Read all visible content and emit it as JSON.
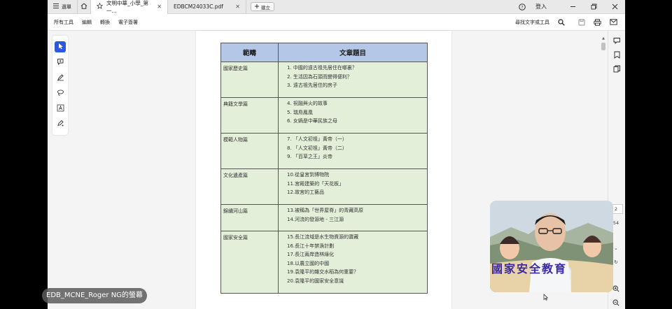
{
  "tabbar": {
    "menu_label": "選單",
    "tabs": [
      {
        "label": "文明中華_小學_第一...",
        "active": true
      },
      {
        "label": "EDBCM24033C.pdf",
        "active": false
      }
    ],
    "new_tab_label": "建立",
    "sign_in_label": "登入"
  },
  "toolbar": {
    "items": [
      "所有工具",
      "編輯",
      "轉換",
      "電子簽署"
    ],
    "find_label": "尋找文字或工具"
  },
  "table": {
    "headers": [
      "範疇",
      "文章題目"
    ],
    "rows": [
      {
        "category": "國家歷史篇",
        "items": [
          "1.  中國的遠古祖先居住在哪裏？",
          "2.  生活因為石頭而變得便利？",
          "3.  遠古祖先居住的房子"
        ]
      },
      {
        "category": "典籍文學篇",
        "items": [
          "4.  祝融與火的故事",
          "5.  瑞鳥鳳凰",
          "6.  女媧是中華民族之母"
        ]
      },
      {
        "category": "模範人物篇",
        "items": [
          "7.  「人文初祖」黃帝（一）",
          "8.  「人文初祖」黃帝（二）",
          "9.  「百草之王」炎帝"
        ]
      },
      {
        "category": "文化遺產篇",
        "items": [
          "10.從皇宮到博物院",
          "11.宮殿建築的「天花板」",
          "12.故宮的工藝品"
        ]
      },
      {
        "category": "錦繡河山篇",
        "items": [
          "13.被稱為「世界屋脊」的青藏高原",
          "14.河流的發源地 - 三江源"
        ]
      },
      {
        "category": "國家安全篇",
        "items": [
          "15.長江流域是水生物資源的寶藏",
          "16.長江十年禁漁計劃",
          "17.長江兩岸造林綠化",
          "18.以農立國的中國",
          "19.袁隆平的雜交水稻為何重要？",
          "20.袁隆平的國家安全意識"
        ]
      }
    ]
  },
  "zoom_panel": {
    "page_number": "2",
    "zoom_value": "54"
  },
  "webcam": {
    "banner_text": "國家安全教育"
  },
  "screen_share_label": "EDB_MCNE_Roger NG的螢幕",
  "colors": {
    "header_bg": "#b5c7e7",
    "cell_bg": "#e3efd9",
    "accent": "#2b59d9"
  }
}
